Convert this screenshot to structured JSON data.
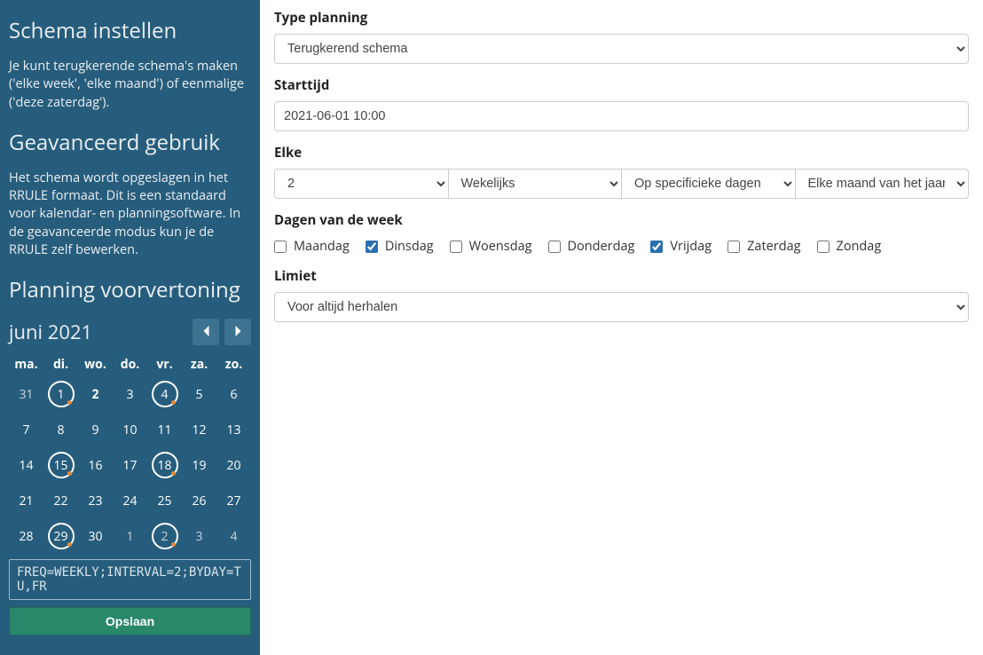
{
  "sidebar": {
    "title1": "Schema instellen",
    "para1": "Je kunt terugkerende schema's maken ('elke week', 'elke maand') of eenmalige ('deze zaterdag').",
    "title2": "Geavanceerd gebruik",
    "para2": "Het schema wordt opgeslagen in het RRULE formaat. Dit is een standaard voor kalendar- en planningsoftware. In de geavanceerde modus kun je de RRULE zelf bewerken.",
    "title3": "Planning voorvertoning",
    "month_label": "juni 2021",
    "weekdays": [
      "ma.",
      "di.",
      "wo.",
      "do.",
      "vr.",
      "za.",
      "zo."
    ],
    "calendar": [
      [
        {
          "n": "31",
          "other": true
        },
        {
          "n": "1",
          "marked": true
        },
        {
          "n": "2",
          "today": true
        },
        {
          "n": "3"
        },
        {
          "n": "4",
          "marked": true
        },
        {
          "n": "5"
        },
        {
          "n": "6"
        }
      ],
      [
        {
          "n": "7"
        },
        {
          "n": "8"
        },
        {
          "n": "9"
        },
        {
          "n": "10"
        },
        {
          "n": "11"
        },
        {
          "n": "12"
        },
        {
          "n": "13"
        }
      ],
      [
        {
          "n": "14"
        },
        {
          "n": "15",
          "marked": true
        },
        {
          "n": "16"
        },
        {
          "n": "17"
        },
        {
          "n": "18",
          "marked": true
        },
        {
          "n": "19"
        },
        {
          "n": "20"
        }
      ],
      [
        {
          "n": "21"
        },
        {
          "n": "22"
        },
        {
          "n": "23"
        },
        {
          "n": "24"
        },
        {
          "n": "25"
        },
        {
          "n": "26"
        },
        {
          "n": "27"
        }
      ],
      [
        {
          "n": "28"
        },
        {
          "n": "29",
          "marked": true
        },
        {
          "n": "30"
        },
        {
          "n": "1",
          "other": true
        },
        {
          "n": "2",
          "other": true,
          "marked": true
        },
        {
          "n": "3",
          "other": true
        },
        {
          "n": "4",
          "other": true
        }
      ]
    ],
    "rrule_value": "FREQ=WEEKLY;INTERVAL=2;BYDAY=TU,FR",
    "save_label": "Opslaan"
  },
  "form": {
    "type_label": "Type planning",
    "type_value": "Terugkerend schema",
    "start_label": "Starttijd",
    "start_value": "2021-06-01 10:00",
    "every_label": "Elke",
    "interval_value": "2",
    "freq_value": "Wekelijks",
    "bysetpos_value": "Op specificieke dagen",
    "bymonth_value": "Elke maand van het jaar",
    "dow_label": "Dagen van de week",
    "days": [
      {
        "label": "Maandag",
        "checked": false
      },
      {
        "label": "Dinsdag",
        "checked": true
      },
      {
        "label": "Woensdag",
        "checked": false
      },
      {
        "label": "Donderdag",
        "checked": false
      },
      {
        "label": "Vrijdag",
        "checked": true
      },
      {
        "label": "Zaterdag",
        "checked": false
      },
      {
        "label": "Zondag",
        "checked": false
      }
    ],
    "limit_label": "Limiet",
    "limit_value": "Voor altijd herhalen"
  }
}
